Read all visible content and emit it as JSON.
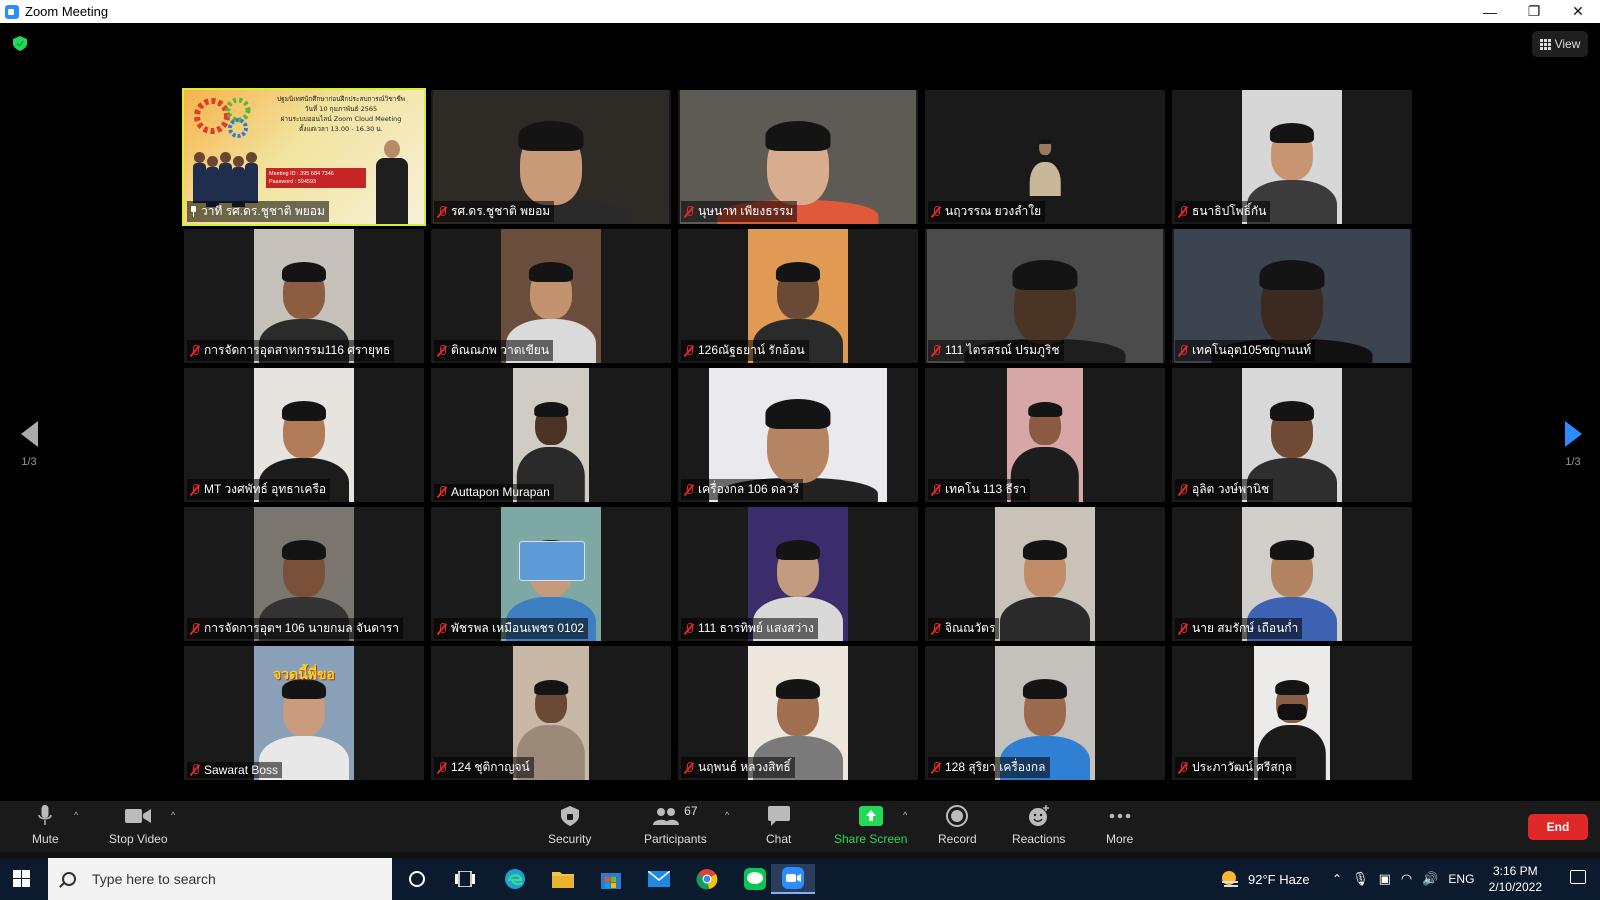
{
  "window": {
    "title": "Zoom Meeting",
    "minimize": "—",
    "restore": "❐",
    "close": "✕"
  },
  "meeting": {
    "view_label": "View",
    "page_indicator_left": "1/3",
    "page_indicator_right": "1/3",
    "tiles": [
      {
        "name": "วาที รศ.ดร.ชูชาติ พยอม",
        "pinned": true,
        "active": true,
        "slide": {
          "line1": "ปฐมนิเทศนักศึกษาก่อนฝึกประสบการณ์วิชาชีพ",
          "line2": "วันที่ 10 กุมภาพันธ์ 2565",
          "line3": "ผ่านระบบออนไลน์ Zoom Cloud Meeting",
          "line4": "ตั้งแต่เวลา 13.00 - 16.30 น.",
          "meeting_id": "Meeting ID : 395 684 7346",
          "password": "Password : 594593"
        }
      },
      {
        "name": "รศ.ดร.ชูชาติ พยอม",
        "bg": "#2e2b27",
        "skin": "#c99a78",
        "shirt": "#2a2a2a",
        "w": 236
      },
      {
        "name": "นุษนาท เพียงธรรม",
        "bg": "#5e5a54",
        "skin": "#d8ac8f",
        "shirt": "#e0593a",
        "w": 236
      },
      {
        "name": "นฤวรรณ ยวงลำใย",
        "bg": "#1a1a1a",
        "skin": "#9a7a5c",
        "shirt": "#c9b79a",
        "w": 80,
        "small": true
      },
      {
        "name": "ธนาธิปโพธิ์กัน",
        "bg": "#d7d7d7",
        "skin": "#c99472",
        "shirt": "#3b3b3b",
        "w": 100
      },
      {
        "name": "การจัดการอุตสาหกรรม116 ศรายุทธ",
        "bg": "#c6c2bb",
        "skin": "#8c5d40",
        "shirt": "#2b2b2b",
        "w": 100
      },
      {
        "name": "ติณณภพ วาดเขียน",
        "bg": "#6a4d3a",
        "skin": "#c3926f",
        "shirt": "#dadada",
        "w": 100
      },
      {
        "name": "126ณัฐธยาน์ รักอ้อน",
        "bg": "#e09a53",
        "skin": "#6b4a35",
        "shirt": "#2b2b2b",
        "w": 100
      },
      {
        "name": "111 ไตรสรณ์ ปรมภูริช",
        "bg": "#4b4b4b",
        "skin": "#4a3426",
        "shirt": "#1e1e1e",
        "w": 236
      },
      {
        "name": "เทคโนอุต105ชญานนท์",
        "bg": "#3c4452",
        "skin": "#3a2a20",
        "shirt": "#111111",
        "w": 236
      },
      {
        "name": "MT วงศพัทธ์ อุทธาเครือ",
        "bg": "#e7e3df",
        "skin": "#b07c58",
        "shirt": "#1c1c1c",
        "w": 100
      },
      {
        "name": "Auttapon Murapan",
        "bg": "#d1ccc3",
        "skin": "#4a3325",
        "shirt": "#2a2a2a",
        "w": 76
      },
      {
        "name": "เครื่องกล 106 ดลวรี",
        "bg": "#e9e9ee",
        "skin": "#b58563",
        "shirt": "#222222",
        "w": 178
      },
      {
        "name": "เทคโน 113 ธีรา",
        "bg": "#d7a7a8",
        "skin": "#8a5a42",
        "shirt": "#1d1d1d",
        "w": 76
      },
      {
        "name": "อุลิต วงษ์พานิช",
        "bg": "#d8d8d8",
        "skin": "#6f4b36",
        "shirt": "#2e2e2e",
        "w": 100
      },
      {
        "name": "การจัดการอุตฯ 106 นายกมล จันดารา",
        "bg": "#7a756e",
        "skin": "#7a5039",
        "shirt": "#333333",
        "w": 100
      },
      {
        "name": "พัชรพล เหมือนเพชร 0102",
        "bg": "#7da8a4",
        "skin": "#c49a7a",
        "shirt": "#3d7fc0",
        "w": 100,
        "card": true
      },
      {
        "name": "111 ธารทิพย์ แสงสว่าง",
        "bg": "#3b2d6b",
        "skin": "#c59b80",
        "shirt": "#d9d9d9",
        "w": 100
      },
      {
        "name": "จิณณวัตร",
        "bg": "#c9c2b8",
        "skin": "#c38c69",
        "shirt": "#2a2a2a",
        "w": 100
      },
      {
        "name": "นาย สมรักษ์ เถือนก่ำ",
        "bg": "#d2cfca",
        "skin": "#b48362",
        "shirt": "#3f63b3",
        "w": 100
      },
      {
        "name": "Sawarat Boss",
        "bg": "#8aa0b8",
        "skin": "#c99c7e",
        "shirt": "#e8e8e8",
        "w": 100,
        "caption": "จวดนี้พี่ขอ"
      },
      {
        "name": "124 ชุติกาญจน์",
        "bg": "#c9b7a8",
        "skin": "#6b4a35",
        "shirt": "#9b8a7a",
        "w": 76
      },
      {
        "name": "นฤพนธ์ หลวงสิทธิ์",
        "bg": "#ede6dc",
        "skin": "#a06f50",
        "shirt": "#7a7a7a",
        "w": 100
      },
      {
        "name": "128 สุริยา เครื่องกล",
        "bg": "#c4c0bb",
        "skin": "#9b6a4c",
        "shirt": "#2f7fd2",
        "w": 100
      },
      {
        "name": "ประภาวัฒน์ ศรีสกุล",
        "bg": "#ecebe9",
        "skin": "#8a5e44",
        "shirt": "#1b1b1b",
        "w": 76,
        "mask": true
      }
    ]
  },
  "toolbar": {
    "mute": "Mute",
    "stop_video": "Stop Video",
    "security": "Security",
    "participants": "Participants",
    "participants_count": "67",
    "chat": "Chat",
    "share_screen": "Share Screen",
    "record": "Record",
    "reactions": "Reactions",
    "more": "More",
    "end": "End",
    "colors": {
      "share": "#23d959",
      "end": "#e02828",
      "accent": "#2d8cff"
    }
  },
  "taskbar": {
    "search_placeholder": "Type here to search",
    "weather": "92°F  Haze",
    "lang": "ENG",
    "time": "3:16 PM",
    "date": "2/10/2022"
  }
}
